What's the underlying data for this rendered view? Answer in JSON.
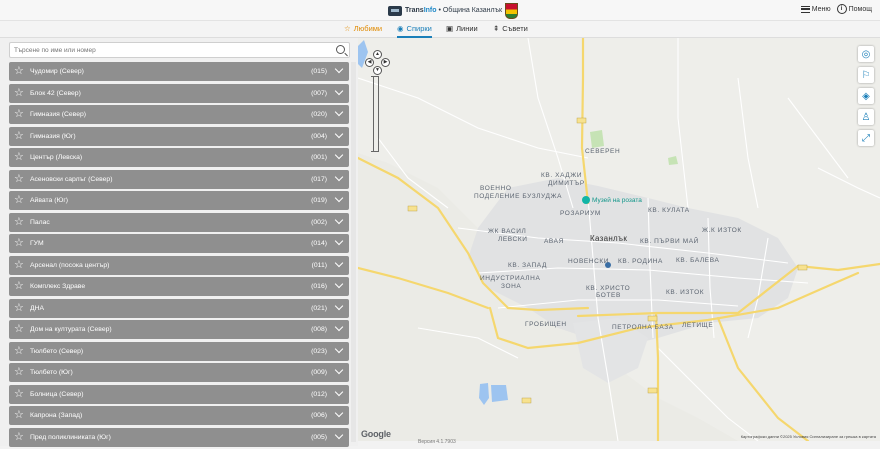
{
  "header": {
    "logo_text_1": "Trans",
    "logo_text_2": "Info",
    "logo_suffix": "• Община Казанлък",
    "menu_label": "Меню",
    "help_label": "Помощ"
  },
  "tabs": [
    {
      "label": "Любими",
      "icon": "star-icon"
    },
    {
      "label": "Спирки",
      "icon": "pin-icon"
    },
    {
      "label": "Линии",
      "icon": "bus-icon"
    },
    {
      "label": "Съвети",
      "icon": "signpost-icon"
    }
  ],
  "search": {
    "placeholder": "Търсене по име или номер"
  },
  "stops": [
    {
      "name": "Чудомир (Север)",
      "code": "(015)"
    },
    {
      "name": "Блок 42 (Север)",
      "code": "(007)"
    },
    {
      "name": "Гимназия (Север)",
      "code": "(020)"
    },
    {
      "name": "Гимназия (Юг)",
      "code": "(004)"
    },
    {
      "name": "Център (Левска)",
      "code": "(001)"
    },
    {
      "name": "Асеновски сарлъг (Север)",
      "code": "(017)"
    },
    {
      "name": "Айвата (Юг)",
      "code": "(019)"
    },
    {
      "name": "Палас",
      "code": "(002)"
    },
    {
      "name": "ГУМ",
      "code": "(014)"
    },
    {
      "name": "Арсенал (посока център)",
      "code": "(011)"
    },
    {
      "name": "Комплекс Здраве",
      "code": "(016)"
    },
    {
      "name": "ДНА",
      "code": "(021)"
    },
    {
      "name": "Дом на културата (Север)",
      "code": "(008)"
    },
    {
      "name": "Тюлбето (Север)",
      "code": "(023)"
    },
    {
      "name": "Тюлбето (Юг)",
      "code": "(009)"
    },
    {
      "name": "Болница (Север)",
      "code": "(012)"
    },
    {
      "name": "Капрона (Запад)",
      "code": "(006)"
    },
    {
      "name": "Пред поликлиниката (Юг)",
      "code": "(005)"
    }
  ],
  "map": {
    "labels": [
      "СЕВЕРЕН",
      "КВ. ХАДЖИ",
      "ДИМИТЪР",
      "ВОЕННО",
      "ПОДЕЛЕНИЕ БУЗЛУДЖА",
      "Музей на розата",
      "РОЗАРИУМ",
      "КВ. КУЛАТА",
      "ЖК ВАСИЛ",
      "ЛЕВСКИ",
      "АВАЯ",
      "Казанлък",
      "КВ. ПЪРВИ МАЙ",
      "Ж.К ИЗТОК",
      "КВ. ЗАПАД",
      "НОВЕНСКИ",
      "КВ. РОДИНА",
      "КВ. БАЛЕВА",
      "ИНДУСТРИАЛНА",
      "ЗОНА",
      "КВ. ХРИСТО",
      "БОТЕВ",
      "КВ. ИЗТОК",
      "ГРОБИЩЕН",
      "ПЕТРОЛНА БАЗА",
      "ЛЕТИЩЕ"
    ],
    "google": "Google",
    "attribution": "Картографски данни ©2025   Условия   Сигнализиране за грешка в картата",
    "controls": [
      "locate-icon",
      "route-icon",
      "pin-icon",
      "user-location-icon",
      "fullscreen-icon"
    ]
  },
  "version": "Версия 4.1.7903"
}
